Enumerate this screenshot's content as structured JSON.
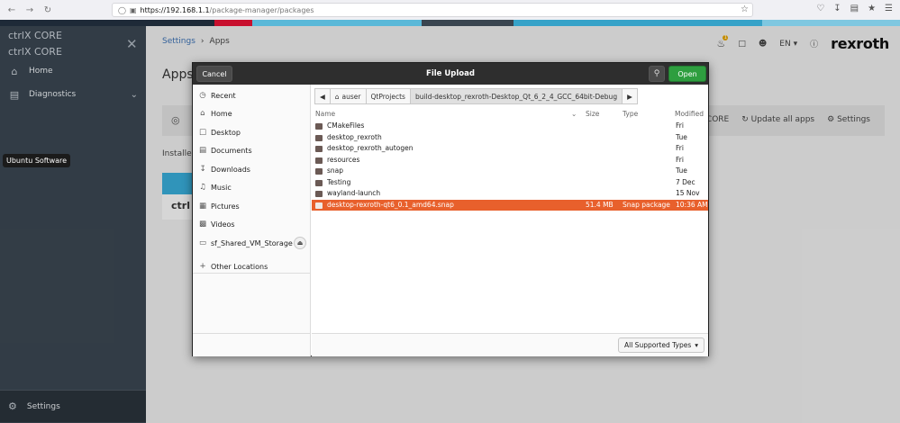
{
  "browser": {
    "url_host": "https://192.168.1.1",
    "url_path": "/package-manager/packages"
  },
  "colors": {
    "brand_strip": [
      "#1e2a38",
      "#c8102e",
      "#5ab8d8",
      "#3a4550",
      "#36a2c8",
      "#7fc7e0"
    ],
    "open_button": "#2e9e3f",
    "selected_row": "#e8602c"
  },
  "sidebar": {
    "title1": "ctrlX CORE",
    "title2": "ctrlX CORE",
    "items": [
      {
        "label": "Home",
        "icon": "home-icon"
      },
      {
        "label": "Diagnostics",
        "icon": "chart-icon"
      }
    ],
    "settings_label": "Settings",
    "tooltip": "Ubuntu Software"
  },
  "main": {
    "breadcrumb_parent": "Settings",
    "breadcrumb_current": "Apps",
    "language": "EN",
    "logo": "rexroth",
    "notif_count": "1",
    "heading": "Apps",
    "toolbar": {
      "core_label": "CORE",
      "update_label": "Update all apps",
      "settings_label": "Settings"
    },
    "installed_label": "Installed",
    "app_card_text": "ctrl"
  },
  "dialog": {
    "title": "File Upload",
    "cancel_label": "Cancel",
    "open_label": "Open",
    "places": [
      {
        "label": "Recent",
        "icon": "clock-icon"
      },
      {
        "label": "Home",
        "icon": "home-icon"
      },
      {
        "label": "Desktop",
        "icon": "desktop-icon"
      },
      {
        "label": "Documents",
        "icon": "document-icon"
      },
      {
        "label": "Downloads",
        "icon": "download-icon"
      },
      {
        "label": "Music",
        "icon": "music-icon"
      },
      {
        "label": "Pictures",
        "icon": "picture-icon"
      },
      {
        "label": "Videos",
        "icon": "video-icon"
      },
      {
        "label": "sf_Shared_VM_Storage",
        "icon": "drive-icon"
      }
    ],
    "other_locations": "Other Locations",
    "path": [
      "auser",
      "QtProjects",
      "build-desktop_rexroth-Desktop_Qt_6_2_4_GCC_64bit-Debug"
    ],
    "columns": {
      "name": "Name",
      "size": "Size",
      "type": "Type",
      "modified": "Modified"
    },
    "files": [
      {
        "name": "CMakeFiles",
        "size": "",
        "type": "",
        "modified": "Fri",
        "kind": "folder"
      },
      {
        "name": "desktop_rexroth",
        "size": "",
        "type": "",
        "modified": "Tue",
        "kind": "folder"
      },
      {
        "name": "desktop_rexroth_autogen",
        "size": "",
        "type": "",
        "modified": "Fri",
        "kind": "folder"
      },
      {
        "name": "resources",
        "size": "",
        "type": "",
        "modified": "Fri",
        "kind": "folder"
      },
      {
        "name": "snap",
        "size": "",
        "type": "",
        "modified": "Tue",
        "kind": "folder"
      },
      {
        "name": "Testing",
        "size": "",
        "type": "",
        "modified": "7 Dec",
        "kind": "folder"
      },
      {
        "name": "wayland-launch",
        "size": "",
        "type": "",
        "modified": "15 Nov",
        "kind": "folder"
      },
      {
        "name": "desktop-rexroth-qt6_0.1_amd64.snap",
        "size": "51.4 MB",
        "type": "Snap package",
        "modified": "10:36 AM",
        "kind": "file"
      }
    ],
    "filter_label": "All Supported Types"
  }
}
